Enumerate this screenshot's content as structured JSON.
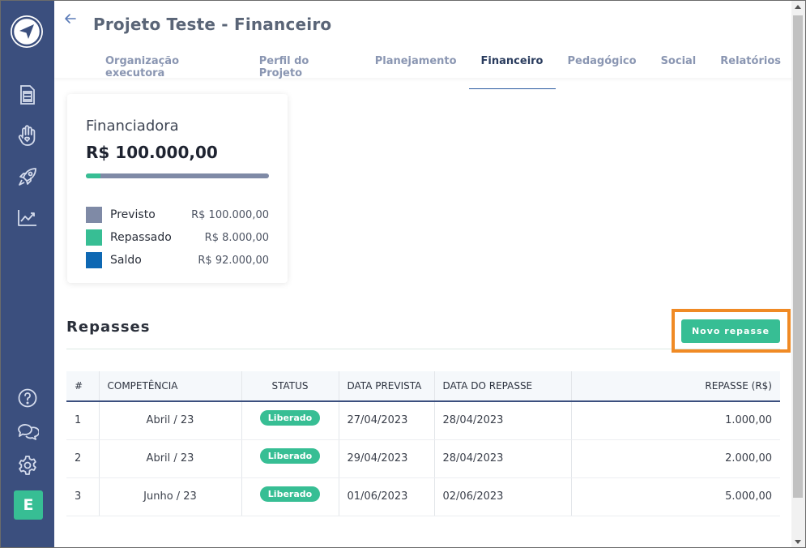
{
  "header": {
    "title": "Projeto Teste - Financeiro",
    "back_icon": "arrow-left-icon",
    "tabs": [
      {
        "label": "Organização executora",
        "active": false
      },
      {
        "label": "Perfil do Projeto",
        "active": false
      },
      {
        "label": "Planejamento",
        "active": false
      },
      {
        "label": "Financeiro",
        "active": true
      },
      {
        "label": "Pedagógico",
        "active": false
      },
      {
        "label": "Social",
        "active": false
      },
      {
        "label": "Relatórios",
        "active": false
      }
    ]
  },
  "sidebar": {
    "logo_icon": "paper-plane-logo-icon",
    "top_icons": [
      "document-icon",
      "hand-heart-icon",
      "rocket-icon",
      "chart-line-icon"
    ],
    "bottom_icons": [
      "help-icon",
      "chat-icon",
      "gear-icon"
    ],
    "avatar_initial": "E"
  },
  "summary": {
    "label": "Financiadora",
    "total": "R$ 100.000,00",
    "progress_fraction": 0.08,
    "legend": [
      {
        "name": "Previsto",
        "value": "R$ 100.000,00",
        "color": "#7f8aa6"
      },
      {
        "name": "Repassado",
        "value": "R$ 8.000,00",
        "color": "#37be94"
      },
      {
        "name": "Saldo",
        "value": "R$ 92.000,00",
        "color": "#0e68b3"
      }
    ]
  },
  "repasses": {
    "title": "Repasses",
    "new_button": "Novo repasse",
    "columns": [
      "#",
      "COMPETÊNCIA",
      "STATUS",
      "DATA PREVISTA",
      "DATA DO REPASSE",
      "REPASSE (R$)"
    ],
    "rows": [
      {
        "num": "1",
        "competencia": "Abril / 23",
        "status": "Liberado",
        "data_prevista": "27/04/2023",
        "data_repasse": "28/04/2023",
        "valor": "1.000,00"
      },
      {
        "num": "2",
        "competencia": "Abril / 23",
        "status": "Liberado",
        "data_prevista": "29/04/2023",
        "data_repasse": "28/04/2023",
        "valor": "2.000,00"
      },
      {
        "num": "3",
        "competencia": "Junho / 23",
        "status": "Liberado",
        "data_prevista": "01/06/2023",
        "data_repasse": "02/06/2023",
        "valor": "5.000,00"
      }
    ]
  },
  "colors": {
    "sidebar": "#3b4f7e",
    "accent_green": "#37be94",
    "highlight_orange": "#f08a24"
  }
}
